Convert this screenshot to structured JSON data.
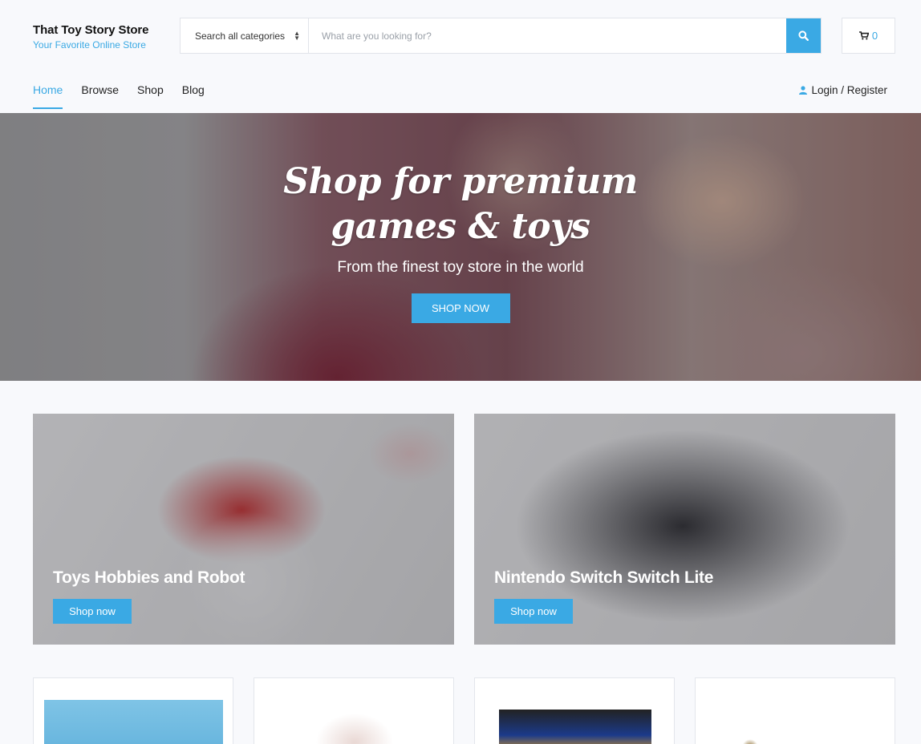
{
  "brand": {
    "name": "That Toy Story Store",
    "tagline": "Your Favorite Online Store"
  },
  "search": {
    "category": "Search all categories",
    "placeholder": "What are you looking for?"
  },
  "cart": {
    "count": "0"
  },
  "nav": {
    "items": [
      {
        "label": "Home",
        "active": true
      },
      {
        "label": "Browse",
        "active": false
      },
      {
        "label": "Shop",
        "active": false
      },
      {
        "label": "Blog",
        "active": false
      }
    ],
    "login": "Login / Register"
  },
  "hero": {
    "title": "Shop for premium games & toys",
    "subtitle": "From the finest toy store in the world",
    "button": "SHOP NOW"
  },
  "banners": [
    {
      "title": "Toys Hobbies and Robot",
      "button": "Shop now"
    },
    {
      "title": "Nintendo Switch Switch Lite",
      "button": "Shop now"
    }
  ],
  "colors": {
    "accent": "#3aa9e4",
    "background": "#f8f9fc"
  }
}
